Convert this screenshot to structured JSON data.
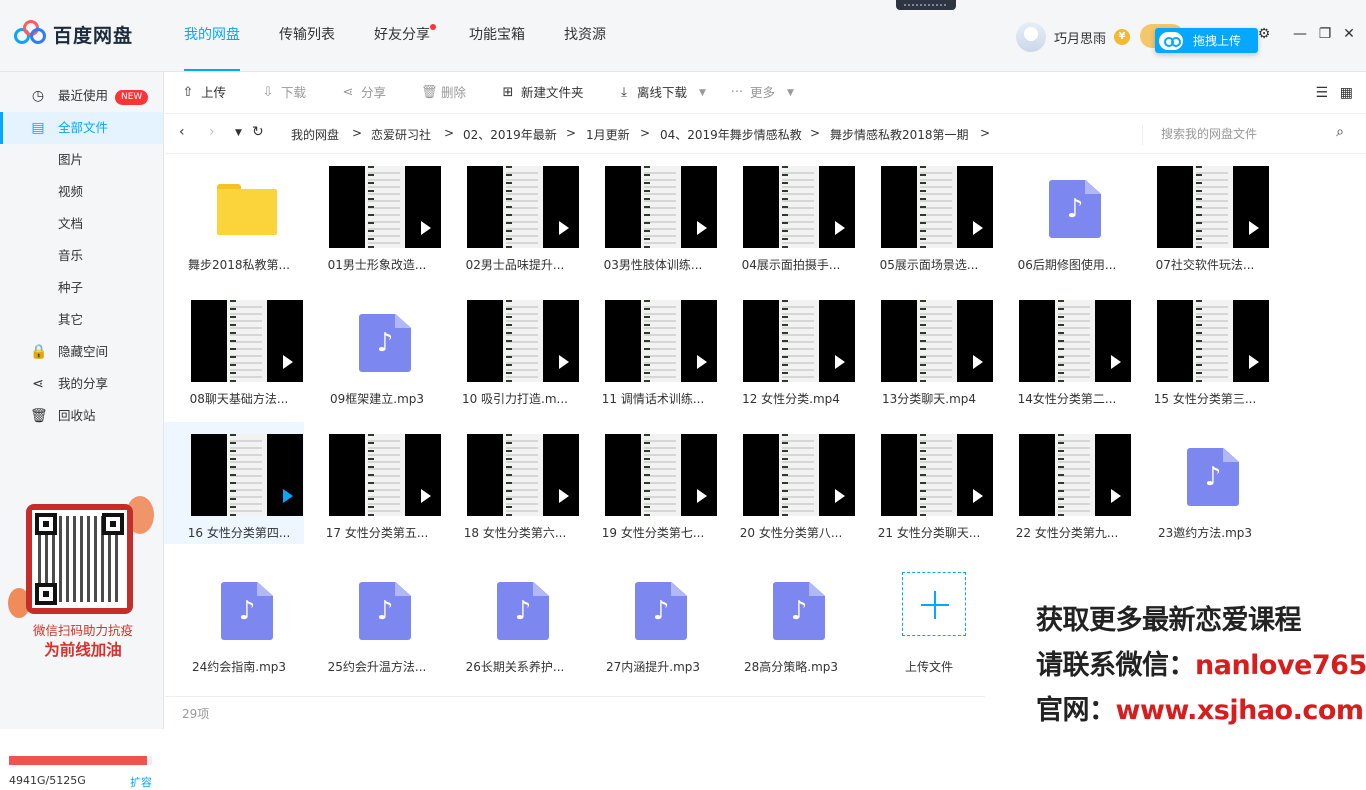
{
  "app": {
    "logo_text": "百度网盘"
  },
  "nav": {
    "tabs": [
      {
        "label": "我的网盘",
        "active": true
      },
      {
        "label": "传输列表",
        "active": false
      },
      {
        "label": "好友分享",
        "active": false,
        "dot": true
      },
      {
        "label": "功能宝箱",
        "active": false
      },
      {
        "label": "找资源",
        "active": false
      }
    ]
  },
  "user": {
    "name": "巧月思雨",
    "coin_icon": "¥",
    "drag_upload": "拖拽上传"
  },
  "window_controls": [
    "settings-icon",
    "minimize-icon",
    "maximize-icon",
    "close-icon"
  ],
  "sidebar": {
    "items": [
      {
        "label": "最近使用",
        "icon": "clock-icon",
        "badge": "NEW"
      },
      {
        "label": "全部文件",
        "icon": "file-icon",
        "active": true
      },
      {
        "label": "图片"
      },
      {
        "label": "视频"
      },
      {
        "label": "文档"
      },
      {
        "label": "音乐"
      },
      {
        "label": "种子"
      },
      {
        "label": "其它"
      },
      {
        "label": "隐藏空间",
        "icon": "lock-icon"
      },
      {
        "label": "我的分享",
        "icon": "share-icon"
      },
      {
        "label": "回收站",
        "icon": "trash-icon"
      }
    ],
    "promo": {
      "line1": "微信扫码助力抗疫",
      "line2": "为前线加油"
    },
    "storage": {
      "text": "4941G/5125G",
      "used_fraction": 0.964,
      "expand": "扩容"
    }
  },
  "toolbar": {
    "upload": "上传",
    "download": "下载",
    "share": "分享",
    "delete": "删除",
    "new_folder": "新建文件夹",
    "offline_download": "离线下载",
    "more": "更多"
  },
  "breadcrumb": {
    "items": [
      "我的网盘",
      "恋爱研习社",
      "02、2019年最新",
      "1月更新",
      "04、2019年舞步情感私教",
      "舞步情感私教2018第一期"
    ],
    "separator": ">",
    "search_placeholder": "搜索我的网盘文件"
  },
  "files": [
    {
      "name": "舞步2018私教第...",
      "type": "folder"
    },
    {
      "name": "01男士形象改造...",
      "type": "video"
    },
    {
      "name": "02男士品味提升...",
      "type": "video"
    },
    {
      "name": "03男性肢体训练...",
      "type": "video"
    },
    {
      "name": "04展示面拍摄手...",
      "type": "video"
    },
    {
      "name": "05展示面场景选...",
      "type": "video"
    },
    {
      "name": "06后期修图使用...",
      "type": "audio"
    },
    {
      "name": "07社交软件玩法...",
      "type": "video"
    },
    {
      "name": "08聊天基础方法...",
      "type": "video"
    },
    {
      "name": "09框架建立.mp3",
      "type": "audio"
    },
    {
      "name": "10 吸引力打造.m...",
      "type": "video"
    },
    {
      "name": "11 调情话术训练...",
      "type": "video"
    },
    {
      "name": "12 女性分类.mp4",
      "type": "video"
    },
    {
      "name": "13分类聊天.mp4",
      "type": "video"
    },
    {
      "name": "14女性分类第二...",
      "type": "video"
    },
    {
      "name": "15 女性分类第三...",
      "type": "video"
    },
    {
      "name": "16 女性分类第四...",
      "type": "video",
      "selected": true
    },
    {
      "name": "17 女性分类第五...",
      "type": "video"
    },
    {
      "name": "18 女性分类第六...",
      "type": "video"
    },
    {
      "name": "19 女性分类第七...",
      "type": "video"
    },
    {
      "name": "20 女性分类第八...",
      "type": "video"
    },
    {
      "name": "21 女性分类聊天...",
      "type": "video"
    },
    {
      "name": "22 女性分类第九...",
      "type": "video"
    },
    {
      "name": "23邀约方法.mp3",
      "type": "audio"
    },
    {
      "name": "24约会指南.mp3",
      "type": "audio"
    },
    {
      "name": "25约会升温方法...",
      "type": "audio"
    },
    {
      "name": "26长期关系养护...",
      "type": "audio"
    },
    {
      "name": "27内涵提升.mp3",
      "type": "audio"
    },
    {
      "name": "28高分策略.mp3",
      "type": "audio"
    },
    {
      "name": "上传文件",
      "type": "add"
    }
  ],
  "footer": {
    "count": "29项"
  },
  "watermark": {
    "line1": "获取更多最新恋爱课程",
    "line2_prefix": "请联系微信：",
    "line2_value": "nanlove765",
    "line3_prefix": "官网：",
    "line3_value": "www.xsjhao.com"
  },
  "colors": {
    "accent": "#06a7ff",
    "audio_icon": "#7c88f0",
    "folder": "#fbd33b",
    "badge": "#ff3333",
    "storage": "#f0524f"
  }
}
